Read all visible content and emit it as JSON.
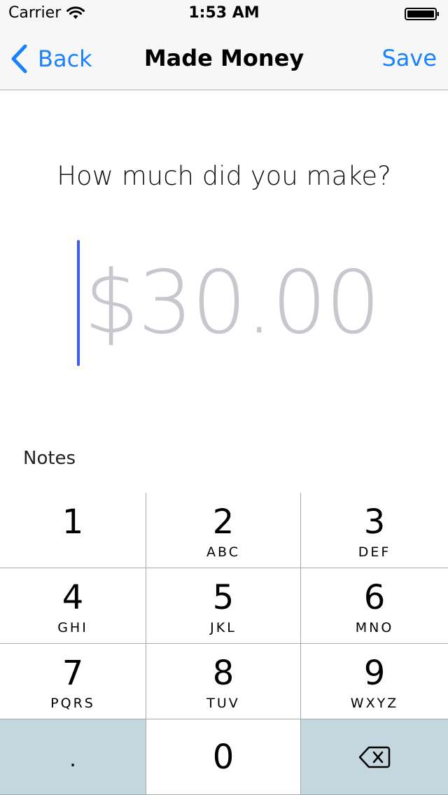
{
  "status_bar": {
    "carrier": "Carrier",
    "time": "1:53 AM"
  },
  "nav": {
    "back_label": "Back",
    "title": "Made Money",
    "save_label": "Save"
  },
  "form": {
    "prompt": "How much did you make?",
    "amount_placeholder": "$30.00",
    "notes_label": "Notes"
  },
  "keypad": {
    "keys": [
      {
        "digit": "1",
        "letters": ""
      },
      {
        "digit": "2",
        "letters": "ABC"
      },
      {
        "digit": "3",
        "letters": "DEF"
      },
      {
        "digit": "4",
        "letters": "GHI"
      },
      {
        "digit": "5",
        "letters": "JKL"
      },
      {
        "digit": "6",
        "letters": "MNO"
      },
      {
        "digit": "7",
        "letters": "PQRS"
      },
      {
        "digit": "8",
        "letters": "TUV"
      },
      {
        "digit": "9",
        "letters": "WXYZ"
      }
    ],
    "decimal": ".",
    "zero": "0",
    "backspace_icon": "backspace-icon"
  },
  "colors": {
    "accent": "#1a82fb",
    "caret": "#3b5de7",
    "placeholder": "#c7c7cd",
    "keypad_dark": "#c4d7df"
  }
}
